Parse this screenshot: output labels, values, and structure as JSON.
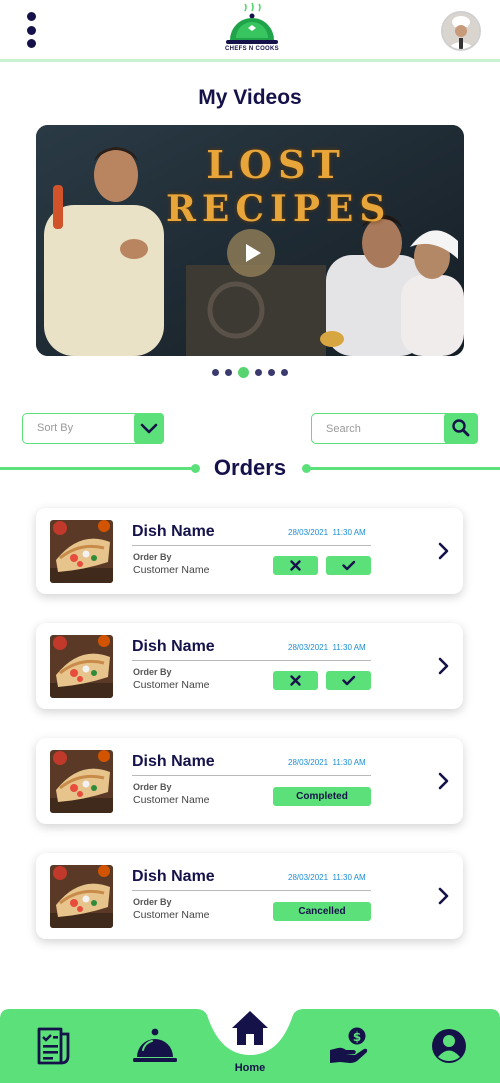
{
  "header": {
    "logo_text": "CHEFS N COOKS",
    "menu_icon": "kebab-menu-icon",
    "avatar_icon": "chef-avatar"
  },
  "videos": {
    "title": "My Videos",
    "featured_title_line1": "LOST",
    "featured_title_line2": "RECIPES",
    "carousel_total": 6,
    "carousel_active_index": 2
  },
  "filters": {
    "sort_label": "Sort By",
    "search_placeholder": "Search"
  },
  "orders": {
    "title": "Orders",
    "items": [
      {
        "dish": "Dish Name",
        "date": "28/03/2021",
        "time": "11:30 AM",
        "order_by_label": "Order By",
        "customer": "Customer Name",
        "status": ""
      },
      {
        "dish": "Dish Name",
        "date": "28/03/2021",
        "time": "11:30 AM",
        "order_by_label": "Order By",
        "customer": "Customer Name",
        "status": ""
      },
      {
        "dish": "Dish Name",
        "date": "28/03/2021",
        "time": "11:30 AM",
        "order_by_label": "Order By",
        "customer": "Customer Name",
        "status": "Completed"
      },
      {
        "dish": "Dish Name",
        "date": "28/03/2021",
        "time": "11:30 AM",
        "order_by_label": "Order By",
        "customer": "Customer Name",
        "status": "Cancelled"
      }
    ]
  },
  "bottom_nav": {
    "home_label": "Home",
    "items": [
      "orders-list-icon",
      "food-cloche-icon",
      "home-icon",
      "earnings-hand-icon",
      "profile-icon"
    ]
  },
  "colors": {
    "accent": "#5be07a",
    "navy": "#15124a",
    "date_blue": "#1a8fd6"
  }
}
